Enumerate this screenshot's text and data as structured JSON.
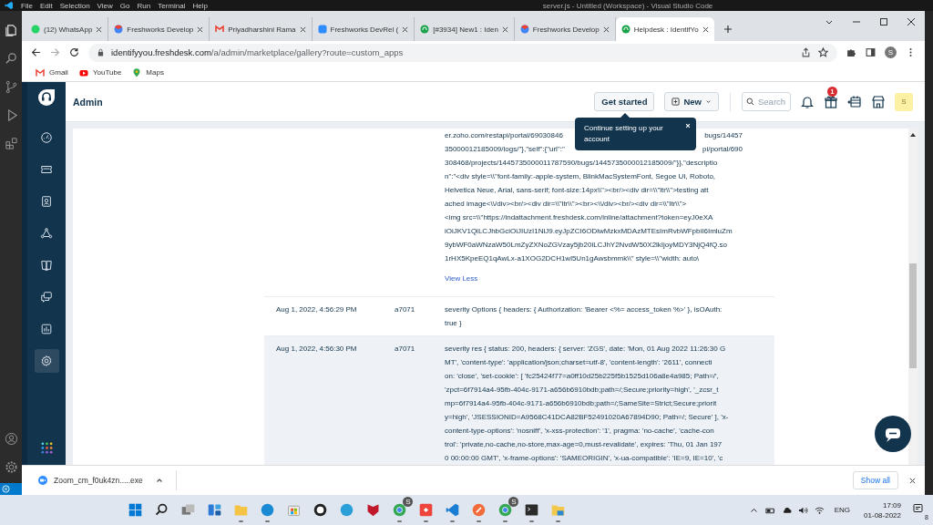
{
  "vscode": {
    "menu": [
      "File",
      "Edit",
      "Selection",
      "View",
      "Go",
      "Run",
      "Terminal",
      "Help"
    ],
    "title": "server.js - Untitled (Workspace) - Visual Studio Code"
  },
  "browser": {
    "tabs": [
      {
        "label": "(12) WhatsApp",
        "kind": "chat",
        "selected": false
      },
      {
        "label": "Freshworks Develop",
        "kind": "browser",
        "selected": false
      },
      {
        "label": "Priyadharshini Rama",
        "kind": "mail",
        "selected": false
      },
      {
        "label": "Freshworks DevRel (",
        "kind": "video",
        "selected": false
      },
      {
        "label": "[#3934] New1 : Iden",
        "kind": "headset",
        "selected": false
      },
      {
        "label": "Freshworks Develop",
        "kind": "browser",
        "selected": false
      },
      {
        "label": "Helpdesk : IdentifYo",
        "kind": "headset",
        "selected": true
      }
    ],
    "url_host": "identifyyou.freshdesk.com",
    "url_path": "/a/admin/marketplace/gallery?route=custom_apps",
    "profile": "S",
    "bookmarks": [
      {
        "label": "Gmail",
        "kind": "mail"
      },
      {
        "label": "YouTube",
        "kind": "video"
      },
      {
        "label": "Maps",
        "kind": "map"
      }
    ]
  },
  "app": {
    "nav": [
      {
        "kind": "gauge",
        "selected": false
      },
      {
        "kind": "ticket",
        "selected": false
      },
      {
        "kind": "contact",
        "selected": false
      },
      {
        "kind": "network",
        "selected": false
      },
      {
        "kind": "book",
        "selected": false
      },
      {
        "kind": "chat",
        "selected": false
      },
      {
        "kind": "chart",
        "selected": false
      },
      {
        "kind": "gear",
        "selected": true
      }
    ],
    "title": "Admin",
    "get_started": "Get started",
    "new_button": "New",
    "search": {
      "placeholder": "Search"
    },
    "gift_badge": "1",
    "avatar": "S",
    "tooltip": "Continue setting up your account"
  },
  "log": {
    "first_lines": [
      {
        "text": "er.zoho.com/restapi/portal/69030846",
        "tail": "bugs/14457"
      },
      {
        "text": "35000012185009/logs/\"},\"self\":{\"url\":\"",
        "tail": "pi/portal/690"
      },
      {
        "text": "308468/projects/1445735000011787590/bugs/1445735000012185009/\"}},\"descriptio"
      },
      {
        "text": "n\":\"<div style=\\\\\"font-family:-apple-system, BlinkMacSystemFont, Segoe UI, Roboto,"
      },
      {
        "text": "Helvetica Neue, Arial, sans-serif; font-size:14px\\\\\"><br/><div dir=\\\\\"ltr\\\\\">testing att"
      },
      {
        "text": "ached image<\\\\/div><br/><div dir=\\\\\"ltr\\\\\"><br><\\\\/div><br/><div dir=\\\\\"ltr\\\\\">"
      },
      {
        "text": "<img src=\\\\\"https://indattachment.freshdesk.com/inline/attachment?token=eyJ0eXA"
      },
      {
        "text": "iOiJKV1QiLCJhbGciOiJIUzI1NiJ9.eyJpZCI6ODlwMzkxMDAzMTEsImRvbWFpbiI6ImluZm"
      },
      {
        "text": "9ybWF0aWNzaW50LmZyZXNoZGVzay5jb20iLCJhY2NvdW50X2lkIjoyMDY3NjQ4fQ.so"
      },
      {
        "text": "1rHX5KpeEQ1qAwLx-a1XOG2DCH1wl5Un1gAwsbmmk\\\\\" style=\\\\\"width: auto\\"
      }
    ],
    "view_less": "View Less",
    "rows": [
      {
        "time": "Aug 1, 2022, 4:56:29 PM",
        "id": "a7071",
        "selected": false,
        "lines": [
          "severity Options { headers: { Authorization: 'Bearer <%= access_token %>' }, isOAuth:",
          "true }"
        ]
      },
      {
        "time": "Aug 1, 2022, 4:56:30 PM",
        "id": "a7071",
        "selected": true,
        "lines": [
          "severity res { status: 200, headers: { server: 'ZGS', date: 'Mon, 01 Aug 2022 11:26:30 G",
          "MT', 'content-type': 'application/json;charset=utf-8', 'content-length': '2611', connecti",
          "on: 'close', 'set-cookie': [ 'fc25424f77=a0ff10d25b225f5b1525d106a8e4a985; Path=/',",
          "'zpct=6f7914a4-95fb-404c-9171-a656b6910bdb;path=/;Secure;priority=high', '_zcsr_t",
          "mp=6f7914a4-95fb-404c-9171-a656b6910bdb;path=/;SameSite=Strict;Secure;priorit",
          "y=high', 'JSESSIONID=A9568C41DCA82BF52491020A67894D90; Path=/; Secure' ], 'x-",
          "content-type-options': 'nosniff', 'x-xss-protection': '1', pragma: 'no-cache', 'cache-con",
          "trol': 'private,no-cache,no-store,max-age=0,must-revalidate', expires: 'Thu, 01 Jan 197",
          "0 00:00:00 GMT', 'x-frame-options': 'SAMEORIGIN', 'x-ua-compatible': 'IE=9, IE=10', 'c"
        ]
      }
    ]
  },
  "download": {
    "file": "Zoom_cm_f0uk4zn.....exe",
    "show_all": "Show all"
  },
  "taskbar": {
    "apps": [
      {
        "kind": "start",
        "running": false
      },
      {
        "kind": "search",
        "running": false
      },
      {
        "kind": "taskview",
        "running": false
      },
      {
        "kind": "widgets",
        "running": false
      },
      {
        "kind": "folder",
        "running": true
      },
      {
        "kind": "edge",
        "running": true
      },
      {
        "kind": "store",
        "running": false
      },
      {
        "kind": "github",
        "running": false
      },
      {
        "kind": "help",
        "running": false
      },
      {
        "kind": "shield",
        "running": false
      },
      {
        "kind": "chrome",
        "running": true,
        "badge": "S"
      },
      {
        "kind": "anydesk",
        "running": true
      },
      {
        "kind": "vscode",
        "running": true
      },
      {
        "kind": "postman",
        "running": true
      },
      {
        "kind": "chrome",
        "running": true,
        "badge": "S"
      },
      {
        "kind": "terminal",
        "running": true
      },
      {
        "kind": "files",
        "running": true
      }
    ],
    "language": "ENG",
    "time": "17:09",
    "date": "01-08-2022",
    "notifications": "8"
  }
}
